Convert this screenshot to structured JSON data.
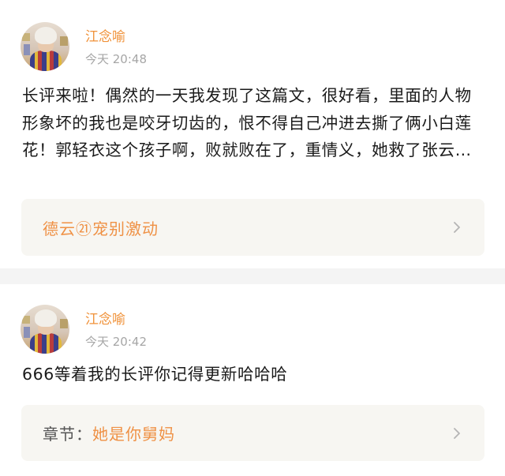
{
  "posts": [
    {
      "username": "江念喻",
      "time": "今天 20:48",
      "body": "长评来啦！偶然的一天我发现了这篇文，很好看，里面的人物形象坏的我也是咬牙切齿的，恨不得自己冲进去撕了俩小白莲花！郭轻衣这个孩子啊，败就败在了，重情义，她救了张云…",
      "link": {
        "prefix": "",
        "label": "德云㉑宠别激动"
      }
    },
    {
      "username": "江念喻",
      "time": "今天 20:42",
      "body": "666等着我的长评你记得更新哈哈哈",
      "link": {
        "prefix": "章节：",
        "label": "她是你舅妈"
      }
    }
  ],
  "icons": {
    "avatar": "avatar-image",
    "chevron": "chevron-right-icon"
  },
  "colors": {
    "username": "#f0923a",
    "link": "#ef9145",
    "time": "#a6a6a6",
    "divider": "#f4f4f4",
    "link_bg": "#f7f6f2"
  }
}
